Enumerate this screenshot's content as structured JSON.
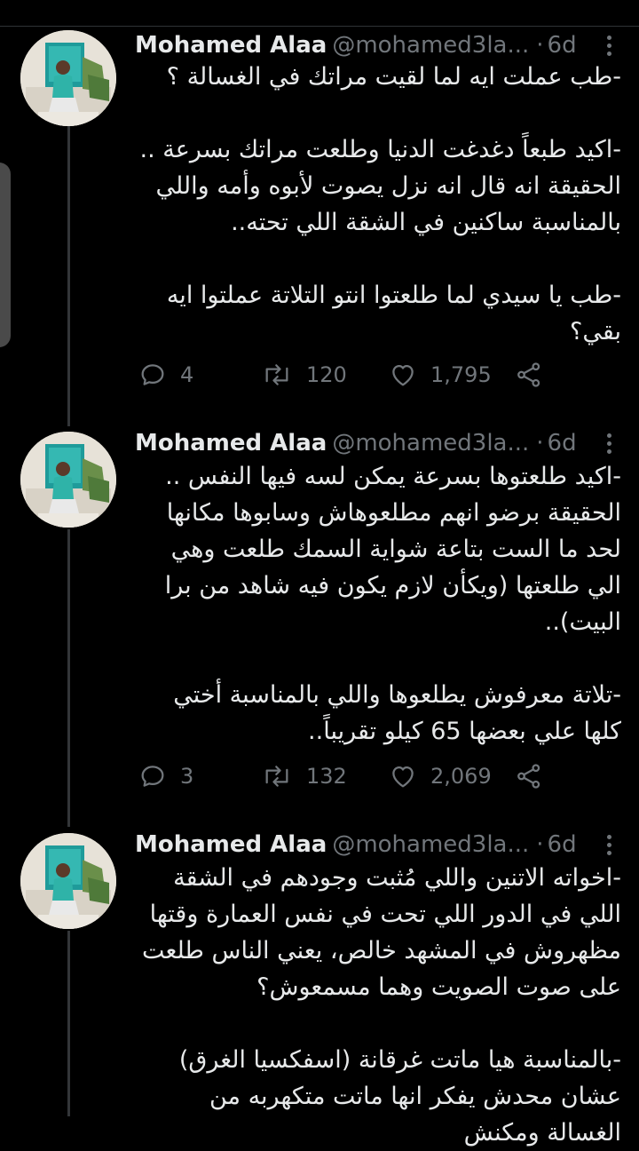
{
  "theme": {
    "background": "#000000",
    "text": "#e7e9ea",
    "muted": "#71767b",
    "thread_line": "#333639"
  },
  "tweets": [
    {
      "name": "Mohamed Alaa",
      "handle": "@mohamed3la...",
      "dot": "·",
      "time": "6d",
      "text": "-طب عملت ايه لما لقيت مراتك في الغسالة ؟\n\n-اكيد طبعاً دغدغت الدنيا وطلعت مراتك بسرعة .. الحقيقة انه قال انه نزل يصوت لأبوه وأمه واللي بالمناسبة ساكنين في الشقة اللي تحته..\n\n-طب يا سيدي لما طلعتوا انتو التلاتة عملتوا ايه بقي؟",
      "replies": "4",
      "retweets": "120",
      "likes": "1,795"
    },
    {
      "name": "Mohamed Alaa",
      "handle": "@mohamed3la...",
      "dot": "·",
      "time": "6d",
      "text": "-اكيد طلعتوها بسرعة يمكن لسه فيها النفس .. الحقيقة برضو انهم مطلعوهاش وسابوها مكانها لحد ما الست بتاعة شواية السمك طلعت وهي الي طلعتها (ويكأن لازم يكون فيه شاهد من برا البيت)..\n\n-تلاتة معرفوش يطلعوها واللي بالمناسبة أختي كلها علي بعضها 65 كيلو تقريباً..",
      "replies": "3",
      "retweets": "132",
      "likes": "2,069"
    },
    {
      "name": "Mohamed Alaa",
      "handle": "@mohamed3la...",
      "dot": "·",
      "time": "6d",
      "text": "-اخواته الاتنين واللي مُثبت وجودهم في الشقة اللي في الدور اللي تحت في نفس العمارة وقتها مظهروش في المشهد خالص، يعني الناس طلعت على صوت الصويت وهما مسمعوش؟\n\n-بالمناسبة هيا ماتت غرقانة (اسفكسيا الغرق) عشان محدش يفكر انها ماتت متكهربه من الغسالة ومكنش"
    }
  ]
}
